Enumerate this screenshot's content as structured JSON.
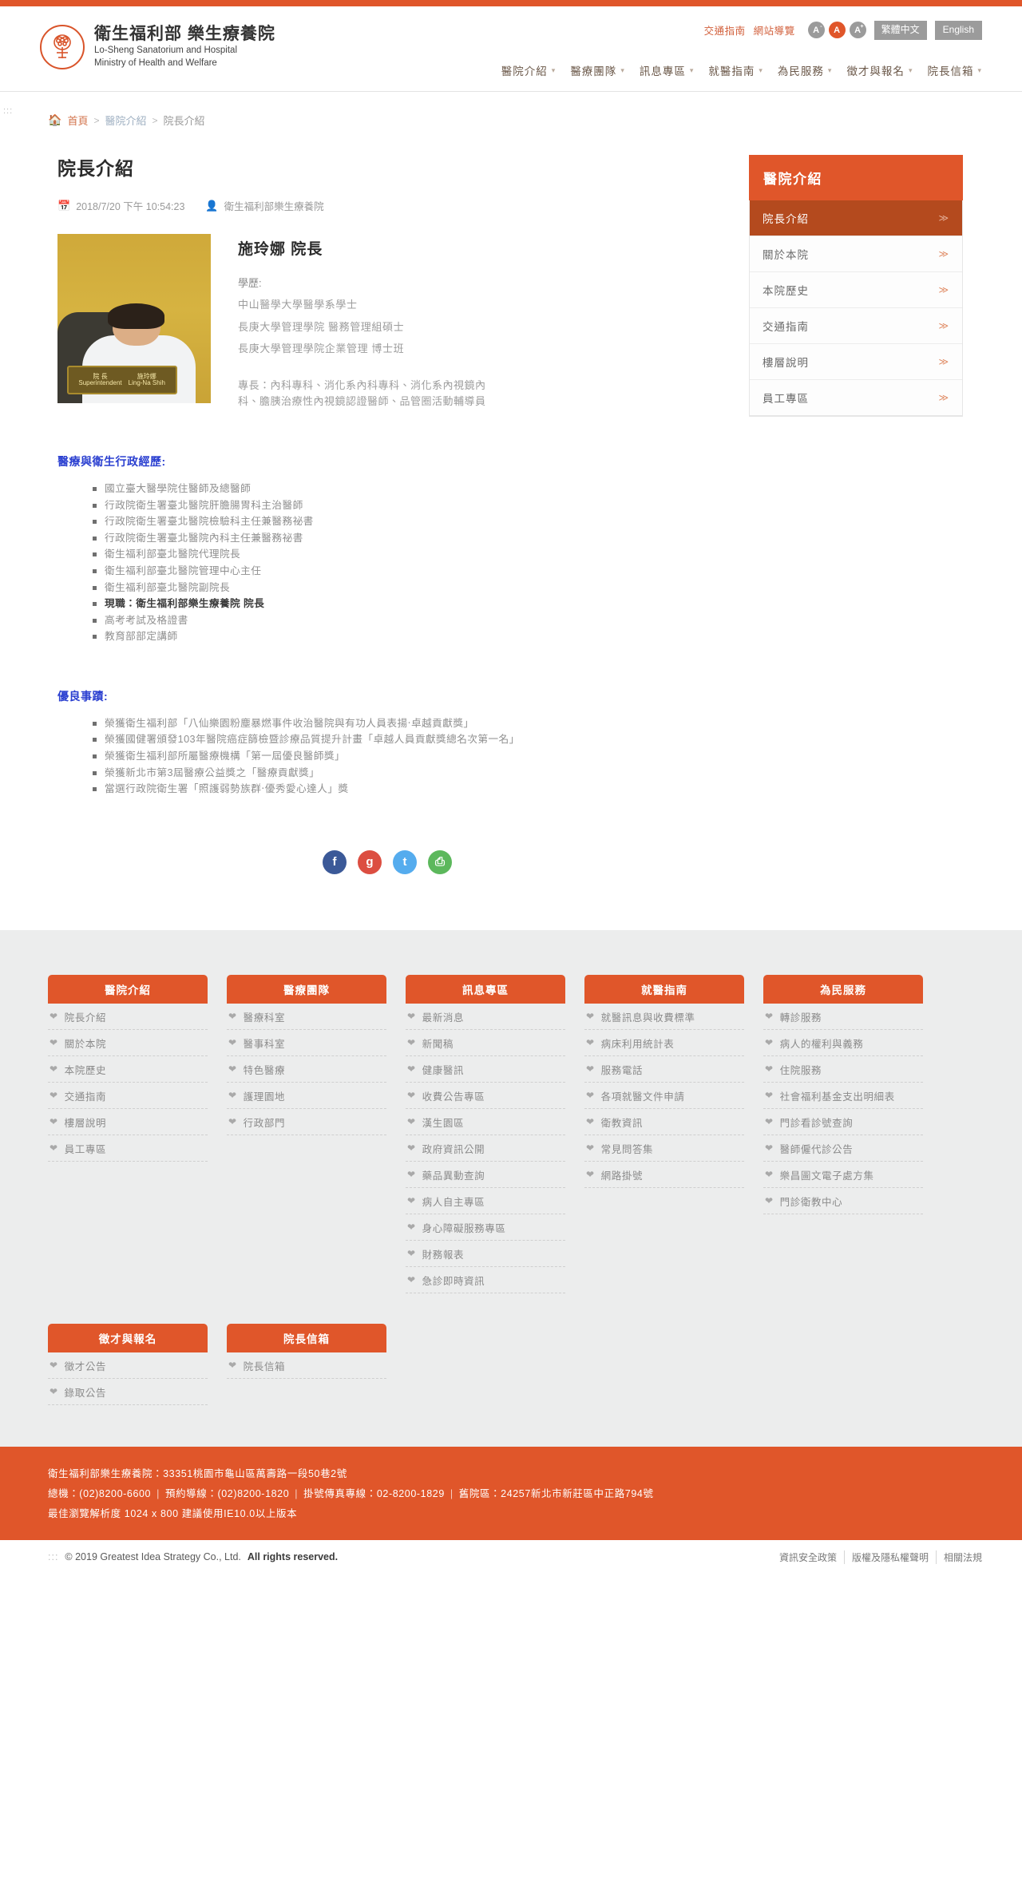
{
  "header": {
    "logo_icon": "hospital-tree-seal-icon",
    "brand_cn": "衛生福利部 樂生療養院",
    "brand_en_1": "Lo-Sheng Sanatorium and Hospital",
    "brand_en_2": "Ministry of Health and Welfare",
    "utility_links": [
      {
        "label": "交通指南",
        "name": "traffic-guide-link"
      },
      {
        "label": "網站導覽",
        "name": "sitemap-link"
      }
    ],
    "font_size": {
      "decrease": "A",
      "normal": "A",
      "increase": "A",
      "decrease_sup": "-",
      "increase_sup": "+"
    },
    "lang_tw": "繁體中文",
    "lang_en": "English",
    "nav": [
      {
        "label": "醫院介紹",
        "name": "nav-hospital-intro"
      },
      {
        "label": "醫療團隊",
        "name": "nav-medical-team"
      },
      {
        "label": "訊息專區",
        "name": "nav-news-zone"
      },
      {
        "label": "就醫指南",
        "name": "nav-visit-guide"
      },
      {
        "label": "為民服務",
        "name": "nav-public-service"
      },
      {
        "label": "徵才與報名",
        "name": "nav-recruitment"
      },
      {
        "label": "院長信箱",
        "name": "nav-director-mailbox"
      }
    ],
    "rail_dots": ":::"
  },
  "breadcrumb": {
    "home_icon": "home-icon",
    "home": "首頁",
    "sep": ">",
    "parent": "醫院介紹",
    "current": "院長介紹"
  },
  "article": {
    "title": "院長介紹",
    "calendar_icon": "calendar-icon",
    "date": "2018/7/20 下午 10:54:23",
    "user_icon": "user-icon",
    "author": "衛生福利部樂生療養院",
    "photo_caption_left": "院 長",
    "photo_caption_left_en": "Superintendent",
    "photo_caption_right": "施玲娜",
    "photo_caption_right_en": "Ling-Na Shih",
    "person_name": "施玲娜 院長",
    "education_label": "學歷:",
    "education": [
      "中山醫學大學醫學系學士",
      "長庚大學管理學院 醫務管理組碩士",
      "長庚大學管理學院企業管理 博士班"
    ],
    "specialty": "專長：內科專科、消化系內科專科、消化系內視鏡內科、膽胰治療性內視鏡認證醫師、品管圈活動輔導員",
    "career_heading": "醫療與衛生行政經歷:",
    "career": [
      {
        "text": "國立臺大醫學院住醫師及總醫師",
        "bold": false
      },
      {
        "text": "行政院衛生署臺北醫院肝膽腸胃科主治醫師",
        "bold": false
      },
      {
        "text": "行政院衛生署臺北醫院檢驗科主任兼醫務祕書",
        "bold": false
      },
      {
        "text": "行政院衛生署臺北醫院內科主任兼醫務祕書",
        "bold": false
      },
      {
        "text": "衛生福利部臺北醫院代理院長",
        "bold": false
      },
      {
        "text": "衛生福利部臺北醫院管理中心主任",
        "bold": false
      },
      {
        "text": "衛生福利部臺北醫院副院長",
        "bold": false
      },
      {
        "text": "現職：衛生福利部樂生療養院 院長",
        "bold": true
      },
      {
        "text": "高考考試及格證書",
        "bold": false
      },
      {
        "text": "教育部部定講師",
        "bold": false
      }
    ],
    "awards_heading": "優良事蹟:",
    "awards": [
      "榮獲衛生福利部「八仙樂園粉塵暴燃事件收治醫院與有功人員表揚‧卓越貢獻獎」",
      "榮獲國健署頒發103年醫院癌症篩檢暨診療品質提升計畫「卓越人員貢獻獎總名次第一名」",
      "榮獲衛生福利部所屬醫療機構「第一屆優良醫師獎」",
      "榮獲新北市第3屆醫療公益獎之「醫療貢獻獎」",
      "當選行政院衛生署「照護弱勢族群‧優秀愛心達人」獎"
    ],
    "share": [
      {
        "label": "f",
        "name": "share-facebook-icon",
        "cls": "fb"
      },
      {
        "label": "g",
        "name": "share-googleplus-icon",
        "cls": "gp"
      },
      {
        "label": "t",
        "name": "share-twitter-icon",
        "cls": "tw"
      },
      {
        "label": "⎙",
        "name": "print-icon",
        "cls": "pr"
      }
    ]
  },
  "aside": {
    "heading": "醫院介紹",
    "items": [
      {
        "label": "院長介紹",
        "active": true,
        "name": "aside-item-director-intro"
      },
      {
        "label": "關於本院",
        "active": false,
        "name": "aside-item-about"
      },
      {
        "label": "本院歷史",
        "active": false,
        "name": "aside-item-history"
      },
      {
        "label": "交通指南",
        "active": false,
        "name": "aside-item-traffic"
      },
      {
        "label": "樓層說明",
        "active": false,
        "name": "aside-item-floor"
      },
      {
        "label": "員工專區",
        "active": false,
        "name": "aside-item-staff"
      }
    ],
    "arrow": "≫"
  },
  "footer": {
    "heart_icon": "heart-pulse-icon",
    "columns_row1": [
      {
        "title": "醫院介紹",
        "links": [
          "院長介紹",
          "關於本院",
          "本院歷史",
          "交通指南",
          "樓層說明",
          "員工專區"
        ]
      },
      {
        "title": "醫療團隊",
        "links": [
          "醫療科室",
          "醫事科室",
          "特色醫療",
          "護理園地",
          "行政部門"
        ]
      },
      {
        "title": "訊息專區",
        "links": [
          "最新消息",
          "新聞稿",
          "健康醫訊",
          "收費公告專區",
          "漢生園區",
          "政府資訊公開",
          "藥品異動查詢",
          "病人自主專區",
          "身心障礙服務專區",
          "財務報表",
          "急診即時資訊"
        ]
      },
      {
        "title": "就醫指南",
        "links": [
          "就醫訊息與收費標準",
          "病床利用統計表",
          "服務電話",
          "各項就醫文件申請",
          "衛教資訊",
          "常見問答集",
          "網路掛號"
        ]
      },
      {
        "title": "為民服務",
        "links": [
          "轉診服務",
          "病人的權利與義務",
          "住院服務",
          "社會福利基金支出明細表",
          "門診看診號查詢",
          "醫師僱代診公告",
          "樂昌圖文電子處方集",
          "門診衛教中心"
        ]
      }
    ],
    "columns_row2": [
      {
        "title": "徵才與報名",
        "links": [
          "徵才公告",
          "錄取公告"
        ]
      },
      {
        "title": "院長信箱",
        "links": [
          "院長信箱"
        ]
      }
    ],
    "contact_line1": "衛生福利部樂生療養院：33351桃園市龜山區萬壽路一段50巷2號",
    "contact_line2_parts": [
      "總機：(02)8200-6600",
      "預約導線：(02)8200-1820",
      "掛號傳真專線：02-8200-1829",
      "舊院區：24257新北市新莊區中正路794號"
    ],
    "contact_line3": "最佳瀏覽解析度 1024 x 800 建議使用IE10.0以上版本",
    "copyright_dots": ":::",
    "copyright": "© 2019 Greatest Idea Strategy Co., Ltd.",
    "copyright_bold": "All rights reserved.",
    "policy_links": [
      "資訊安全政策",
      "版權及隱私權聲明",
      "相關法規"
    ]
  },
  "colors": {
    "accent": "#e0562a",
    "accent_dark": "#b44a1e",
    "heading_blue": "#2a3fd0",
    "footer_bg": "#eceded"
  }
}
